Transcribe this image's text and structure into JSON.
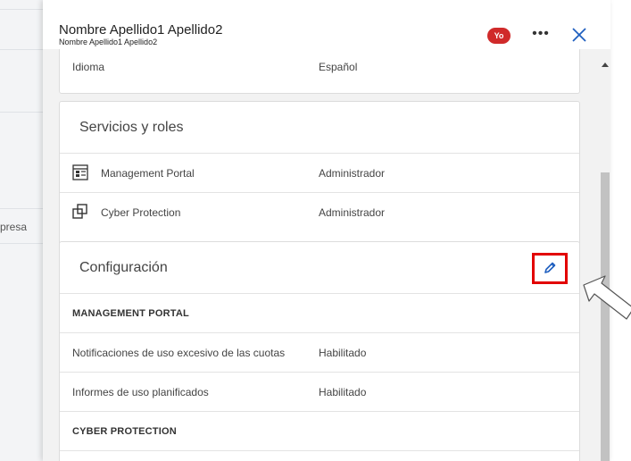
{
  "background": {
    "visible_text": "presa"
  },
  "header": {
    "title": "Nombre Apellido1 Apellido2",
    "subtitle": "Nombre Apellido1 Apellido2",
    "badge": "Yo",
    "more_label": "•••"
  },
  "profile": {
    "language_label": "Idioma",
    "language_value": "Español"
  },
  "services": {
    "title": "Servicios y roles",
    "items": [
      {
        "name": "Management Portal",
        "role": "Administrador",
        "icon": "management-portal-icon"
      },
      {
        "name": "Cyber Protection",
        "role": "Administrador",
        "icon": "cyber-protection-icon"
      }
    ]
  },
  "config": {
    "title": "Configuración",
    "sections": [
      {
        "heading": "MANAGEMENT PORTAL",
        "rows": [
          {
            "label": "Notificaciones de uso excesivo de las cuotas",
            "value": "Habilitado"
          },
          {
            "label": "Informes de uso planificados",
            "value": "Habilitado"
          }
        ]
      },
      {
        "heading": "CYBER PROTECTION",
        "rows": []
      }
    ]
  },
  "colors": {
    "accent": "#1f5fbf",
    "badge": "#d02a2a",
    "highlight": "#e20000"
  }
}
